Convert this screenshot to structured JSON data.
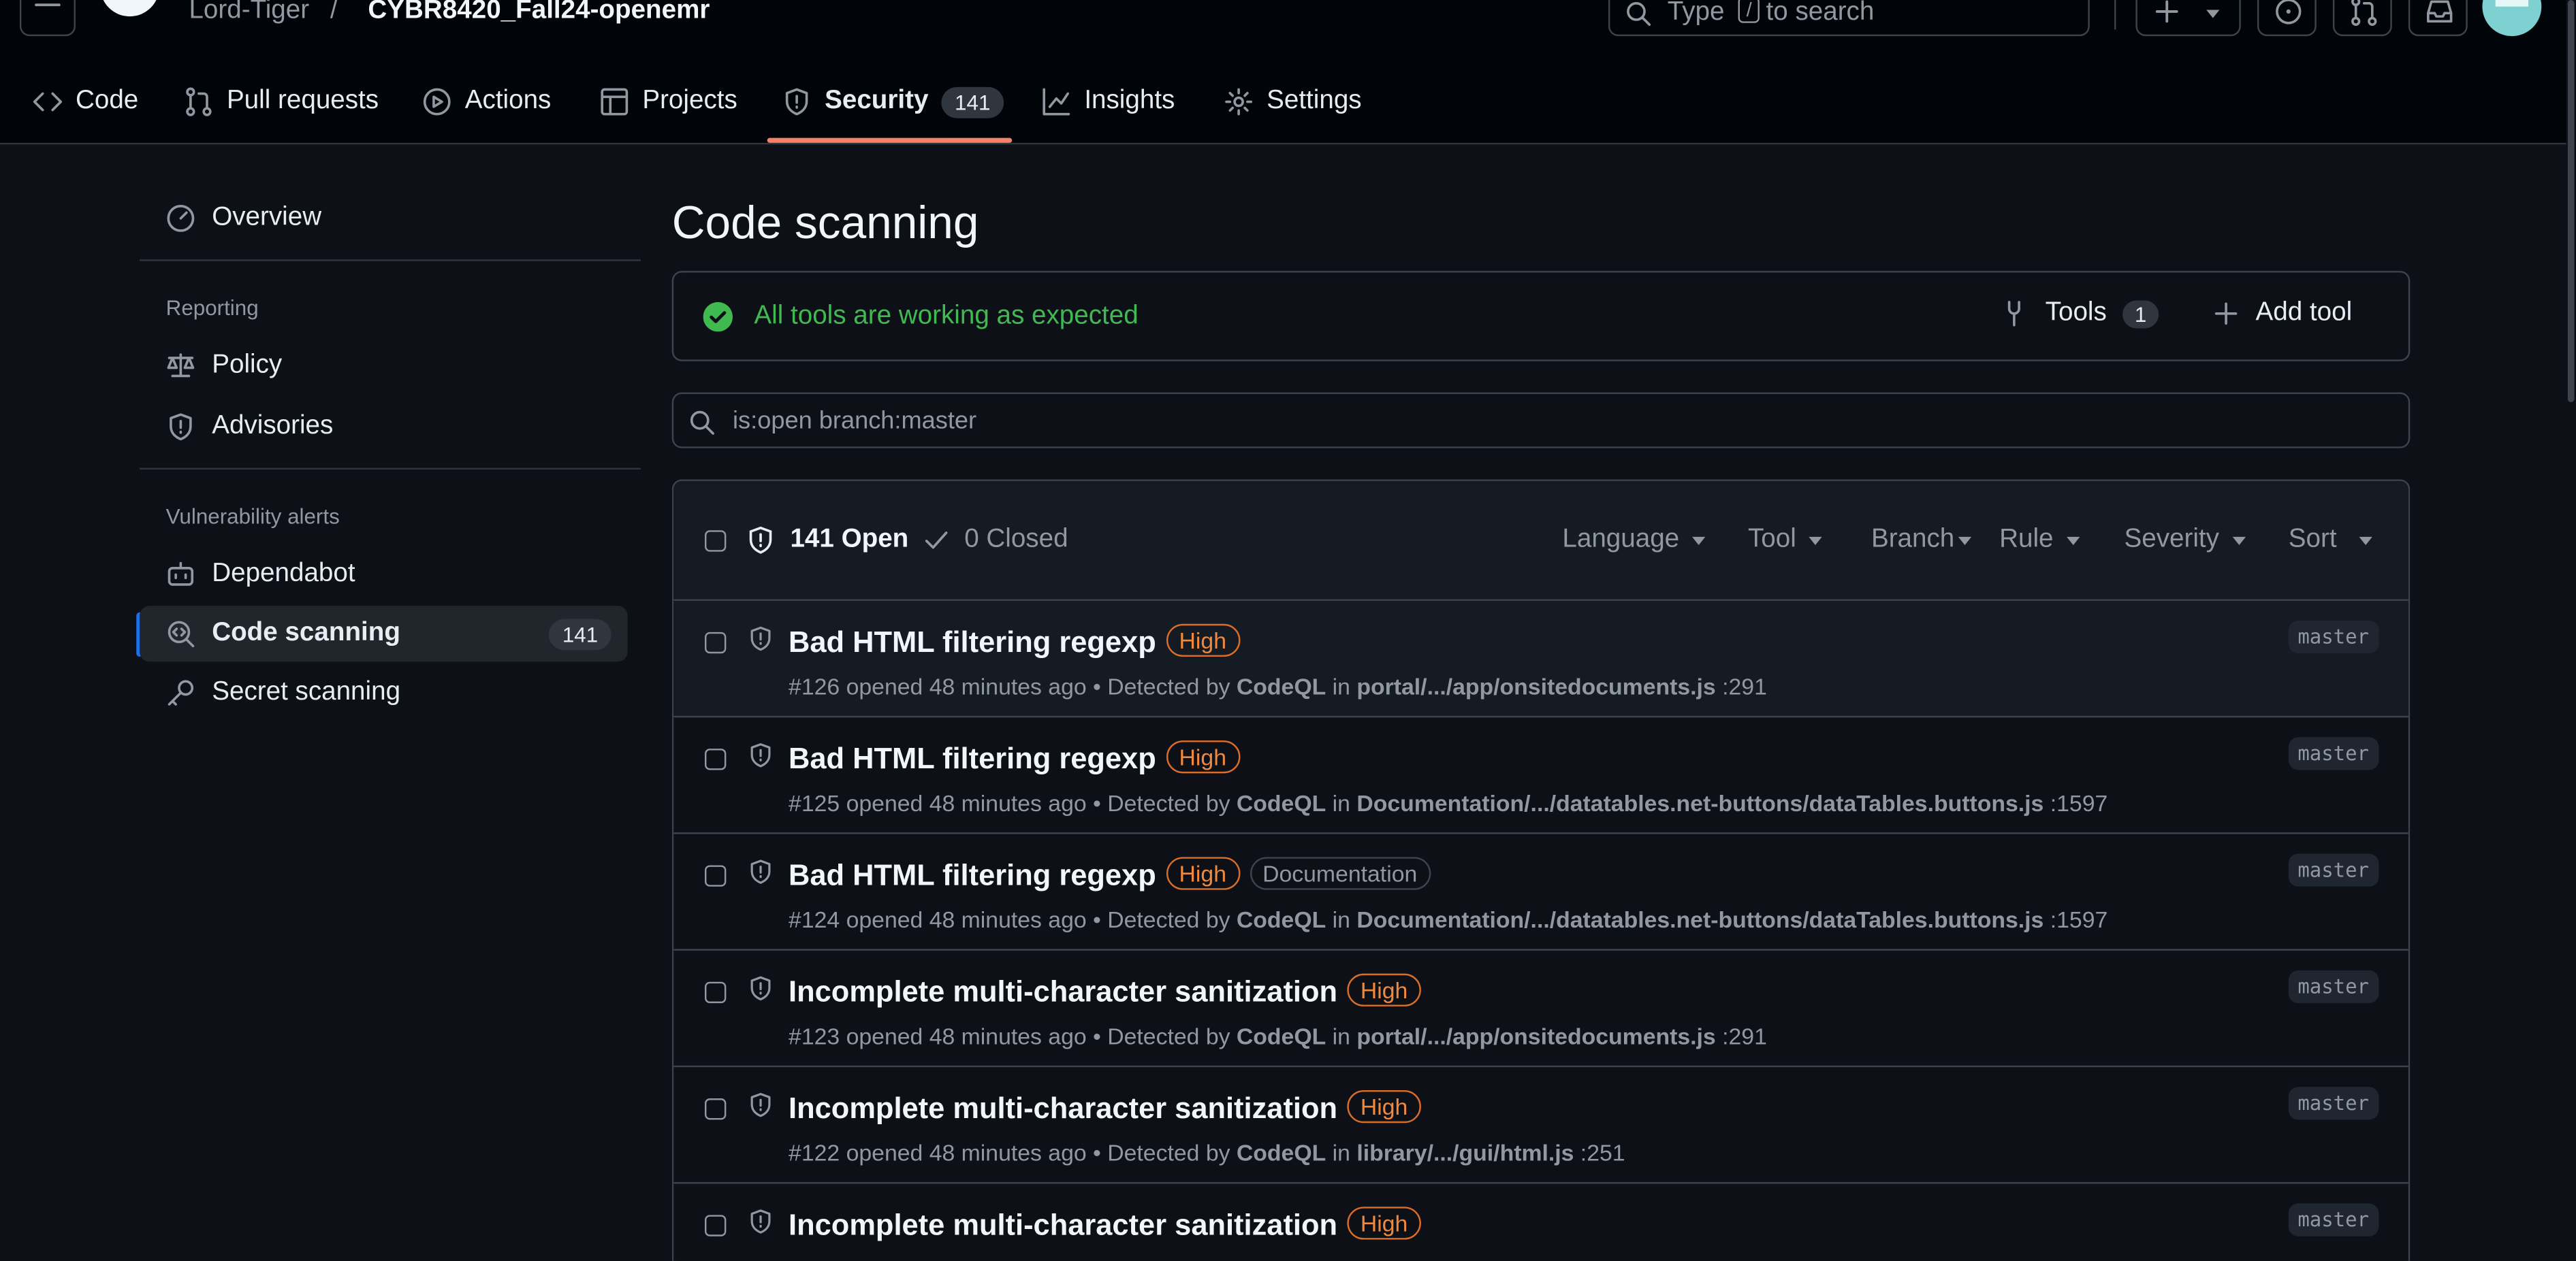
{
  "header": {
    "owner": "Lord-Tiger",
    "separator": "/",
    "repo": "CYBR8420_Fall24-openemr",
    "search_prefix": "Type",
    "search_key": "/",
    "search_suffix": "to search"
  },
  "tabs": [
    {
      "label": "Code",
      "icon": "code-icon"
    },
    {
      "label": "Pull requests",
      "icon": "pull-request-icon"
    },
    {
      "label": "Actions",
      "icon": "play-icon"
    },
    {
      "label": "Projects",
      "icon": "table-icon"
    },
    {
      "label": "Security",
      "icon": "shield-icon",
      "count": "141",
      "selected": true
    },
    {
      "label": "Insights",
      "icon": "graph-icon"
    },
    {
      "label": "Settings",
      "icon": "gear-icon"
    }
  ],
  "sidebar": {
    "overview": "Overview",
    "reporting_heading": "Reporting",
    "policy": "Policy",
    "advisories": "Advisories",
    "vuln_heading": "Vulnerability alerts",
    "dependabot": "Dependabot",
    "code_scanning": "Code scanning",
    "code_scanning_count": "141",
    "secret_scanning": "Secret scanning"
  },
  "main": {
    "title": "Code scanning",
    "status_text": "All tools are working as expected",
    "tools_label": "Tools",
    "tools_count": "1",
    "add_tool_label": "Add tool",
    "filter_query": "is:open branch:master"
  },
  "alerts_header": {
    "open_label": "141 Open",
    "closed_label": "0 Closed",
    "filters": [
      "Language",
      "Tool",
      "Branch",
      "Rule",
      "Severity",
      "Sort"
    ]
  },
  "alerts": [
    {
      "title": "Bad HTML filtering regexp",
      "severity": "High",
      "tag": "",
      "number": "#126",
      "opened": "opened 48 minutes ago • Detected by",
      "tool": "CodeQL",
      "in": "in",
      "path": "portal/.../app/onsitedocuments.js",
      "line": ":291",
      "branch": "master"
    },
    {
      "title": "Bad HTML filtering regexp",
      "severity": "High",
      "tag": "",
      "number": "#125",
      "opened": "opened 48 minutes ago • Detected by",
      "tool": "CodeQL",
      "in": "in",
      "path": "Documentation/.../datatables.net-buttons/dataTables.buttons.js",
      "line": ":1597",
      "branch": "master"
    },
    {
      "title": "Bad HTML filtering regexp",
      "severity": "High",
      "tag": "Documentation",
      "number": "#124",
      "opened": "opened 48 minutes ago • Detected by",
      "tool": "CodeQL",
      "in": "in",
      "path": "Documentation/.../datatables.net-buttons/dataTables.buttons.js",
      "line": ":1597",
      "branch": "master"
    },
    {
      "title": "Incomplete multi-character sanitization",
      "severity": "High",
      "tag": "",
      "number": "#123",
      "opened": "opened 48 minutes ago • Detected by",
      "tool": "CodeQL",
      "in": "in",
      "path": "portal/.../app/onsitedocuments.js",
      "line": ":291",
      "branch": "master"
    },
    {
      "title": "Incomplete multi-character sanitization",
      "severity": "High",
      "tag": "",
      "number": "#122",
      "opened": "opened 48 minutes ago • Detected by",
      "tool": "CodeQL",
      "in": "in",
      "path": "library/.../gui/html.js",
      "line": ":251",
      "branch": "master"
    },
    {
      "title": "Incomplete multi-character sanitization",
      "severity": "High",
      "tag": "",
      "number": "",
      "opened": "",
      "tool": "",
      "in": "",
      "path": "",
      "line": "",
      "branch": "master"
    }
  ],
  "colors": {
    "background": "#0d1117",
    "header_bg": "#010409",
    "accent_underline": "#f78166",
    "success": "#3fb950",
    "severity_high": "#f0883e",
    "active_bar": "#1f6feb"
  }
}
